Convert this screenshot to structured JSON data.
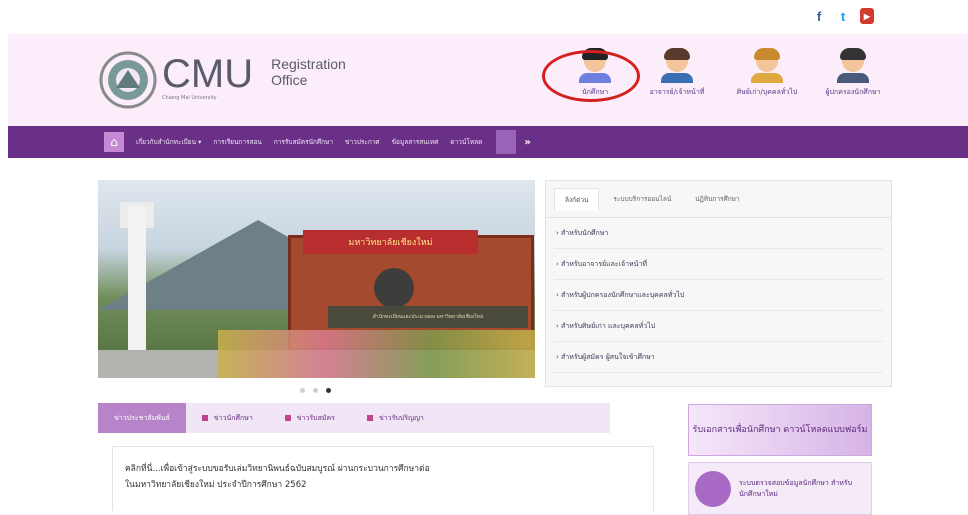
{
  "social": [
    "f",
    "t",
    "▶"
  ],
  "header": {
    "brand": "CMU",
    "brand_sub": "Chiang Mai University",
    "office_line1": "Registration",
    "office_line2": "Office"
  },
  "personas": [
    {
      "label": "นักศึกษา"
    },
    {
      "label": "อาจารย์/เจ้าหน้าที่"
    },
    {
      "label": "ศิษย์เก่า/บุคคลทั่วไป"
    },
    {
      "label": "ผู้ปกครองนักศึกษา"
    }
  ],
  "nav": {
    "items": [
      "เกี่ยวกับสำนักทะเบียน ▾",
      "การเรียนการสอน",
      "การรับสมัครนักศึกษา",
      "ข่าวประกาศ",
      "ข้อมูลสารสนเทศ",
      "ดาวน์โหลด"
    ],
    "more": "»"
  },
  "slider": {
    "sign": "มหาวิทยาลัยเชียงใหม่",
    "base": "สำนักทะเบียนและประมวลผล มหาวิทยาลัยเชียงใหม่"
  },
  "panel": {
    "tabs": [
      "ลิงก์ด่วน",
      "ระบบบริการออนไลน์",
      "ปฏิทินการศึกษา"
    ],
    "links": [
      "› สำหรับนักศึกษา",
      "› สำหรับอาจารย์และเจ้าหน้าที่",
      "› สำหรับผู้ปกครองนักศึกษาและบุคคลทั่วไป",
      "› สำหรับศิษย์เก่า และบุคคลทั่วไป",
      "› สำหรับผู้สมัคร ผู้สนใจเข้าศึกษา"
    ]
  },
  "news_tabs": [
    "ข่าวประชาสัมพันธ์",
    "ข่าวนักศึกษา",
    "ข่าวรับสมัคร",
    "ข่าวรับปริญญา"
  ],
  "news": {
    "line1": "คลิกที่นี่...เพื่อเข้าสู่ระบบขอรับเล่มวิทยานิพนธ์ฉบับสมบูรณ์ ผ่านกระบวนการศึกษาต่อ",
    "line2": "ในมหาวิทยาลัยเชียงใหม่ ประจำปีการศึกษา 2562"
  },
  "banners": {
    "banner1": "รับเอกสารเพื่อนักศึกษา ดาวน์โหลดแบบฟอร์ม",
    "banner2": "ระบบตรวจสอบข้อมูลนักศึกษา สำหรับนักศึกษาใหม่"
  }
}
